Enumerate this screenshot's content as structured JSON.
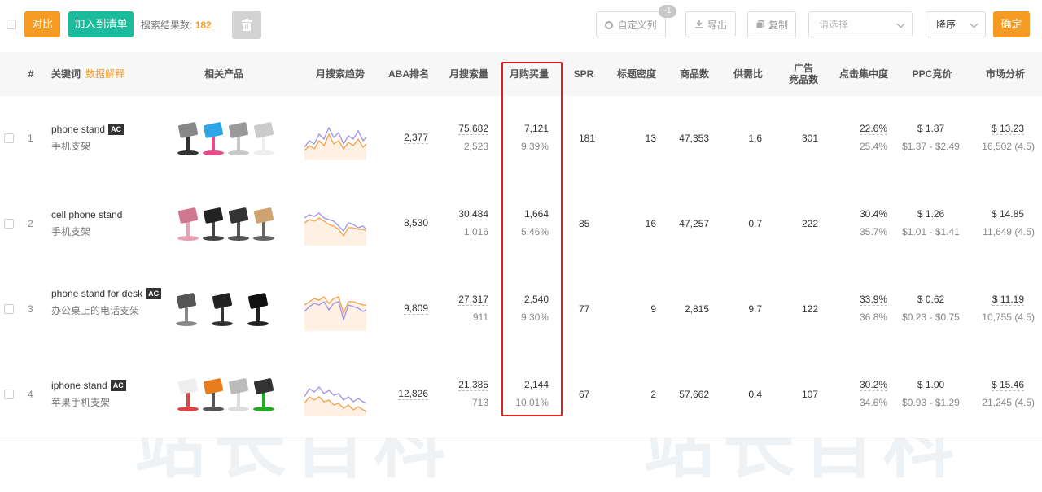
{
  "toolbar": {
    "compare_label": "对比",
    "add_list_label": "加入到清单",
    "result_label": "搜索结果数:",
    "result_count": "182",
    "custom_cols_label": "自定义列",
    "custom_cols_badge": "-1",
    "export_label": "导出",
    "copy_label": "复制",
    "select_placeholder": "请选择",
    "sort_value": "降序",
    "confirm_label": "确定"
  },
  "watermark": "站长百科",
  "columns": {
    "index": "#",
    "keyword": "关键词",
    "keyword_help": "数据解释",
    "products": "相关产品",
    "trend": "月搜索趋势",
    "aba": "ABA排名",
    "monthly_search": "月搜索量",
    "monthly_purchase": "月购买量",
    "spr": "SPR",
    "title_density": "标题密度",
    "product_count": "商品数",
    "supply_demand": "供需比",
    "ad_count": "广告\n竞品数",
    "click_conc": "点击集中度",
    "ppc": "PPC竞价",
    "market": "市场分析"
  },
  "rows": [
    {
      "idx": "1",
      "keyword": "phone stand",
      "ac": "AC",
      "zh": "手机支架",
      "aba": "2,377",
      "search": "75,682",
      "search_sub": "2,523",
      "purchase": "7,121",
      "purchase_rate": "9.39%",
      "spr": "181",
      "density": "13",
      "products": "47,353",
      "sd": "1.6",
      "ads": "301",
      "click": "22.6%",
      "click_sub": "25.4%",
      "ppc": "$ 1.87",
      "ppc_range": "$1.37 - $2.49",
      "market": "$ 13.23",
      "market_sub": "16,502 (4.5)"
    },
    {
      "idx": "2",
      "keyword": "cell phone stand",
      "ac": "",
      "zh": "手机支架",
      "aba": "8,530",
      "search": "30,484",
      "search_sub": "1,016",
      "purchase": "1,664",
      "purchase_rate": "5.46%",
      "spr": "85",
      "density": "16",
      "products": "47,257",
      "sd": "0.7",
      "ads": "222",
      "click": "30.4%",
      "click_sub": "35.7%",
      "ppc": "$ 1.26",
      "ppc_range": "$1.01 - $1.41",
      "market": "$ 14.85",
      "market_sub": "11,649 (4.5)"
    },
    {
      "idx": "3",
      "keyword": "phone stand for desk",
      "ac": "AC",
      "zh": "办公桌上的电话支架",
      "aba": "9,809",
      "search": "27,317",
      "search_sub": "911",
      "purchase": "2,540",
      "purchase_rate": "9.30%",
      "spr": "77",
      "density": "9",
      "products": "2,815",
      "sd": "9.7",
      "ads": "122",
      "click": "33.9%",
      "click_sub": "36.8%",
      "ppc": "$ 0.62",
      "ppc_range": "$0.23 - $0.75",
      "market": "$ 11.19",
      "market_sub": "10,755 (4.5)"
    },
    {
      "idx": "4",
      "keyword": "iphone stand",
      "ac": "AC",
      "zh": "苹果手机支架",
      "aba": "12,826",
      "search": "21,385",
      "search_sub": "713",
      "purchase": "2,144",
      "purchase_rate": "10.01%",
      "spr": "67",
      "density": "2",
      "products": "57,662",
      "sd": "0.4",
      "ads": "107",
      "click": "30.2%",
      "click_sub": "34.6%",
      "ppc": "$ 1.00",
      "ppc_range": "$0.93 - $1.29",
      "market": "$ 15.46",
      "market_sub": "21,245 (4.5)"
    }
  ],
  "colors": {
    "accent": "#f59a23",
    "teal": "#1bbc9b",
    "highlight_box": "#e02020"
  }
}
